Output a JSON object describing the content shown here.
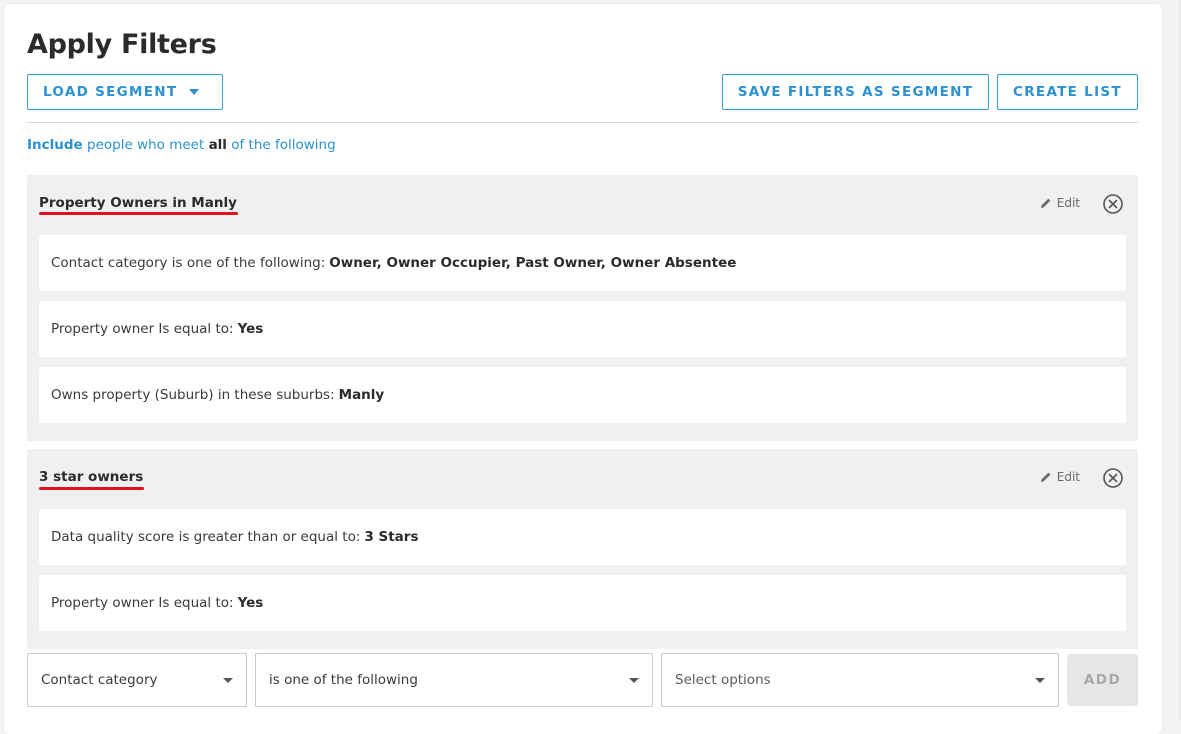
{
  "header": {
    "title": "Apply Filters",
    "load_segment_label": "LOAD SEGMENT",
    "save_filters_label": "SAVE FILTERS AS SEGMENT",
    "create_list_label": "CREATE LIST"
  },
  "include": {
    "word_include": "Include",
    "text_middle": "people who meet",
    "word_all": "all",
    "text_end": "of the following"
  },
  "segments": [
    {
      "title": "Property Owners in Manly",
      "edit_label": "Edit",
      "rules": [
        {
          "label": "Contact category is one of the following:",
          "value": "Owner, Owner Occupier, Past Owner, Owner Absentee"
        },
        {
          "label": "Property owner Is equal to:",
          "value": "Yes"
        },
        {
          "label": "Owns property (Suburb) in these suburbs:",
          "value": "Manly"
        }
      ]
    },
    {
      "title": "3 star owners",
      "edit_label": "Edit",
      "rules": [
        {
          "label": "Data quality score is greater than or equal to:",
          "value": "3 Stars"
        },
        {
          "label": "Property owner Is equal to:",
          "value": "Yes"
        }
      ]
    }
  ],
  "new_filter": {
    "field_value": "Contact category",
    "operator_value": "is one of the following",
    "options_placeholder": "Select options",
    "add_label": "ADD"
  },
  "colors": {
    "accent": "#2b91cf",
    "underline": "#e0101c",
    "segment_bg": "#f0f0f0",
    "disabled_button": "#e6e6e6"
  },
  "icons": {
    "load_caret": "caret-down-icon",
    "edit": "pencil-icon",
    "remove": "circle-x-icon",
    "select_arrow": "chevron-down-icon"
  }
}
